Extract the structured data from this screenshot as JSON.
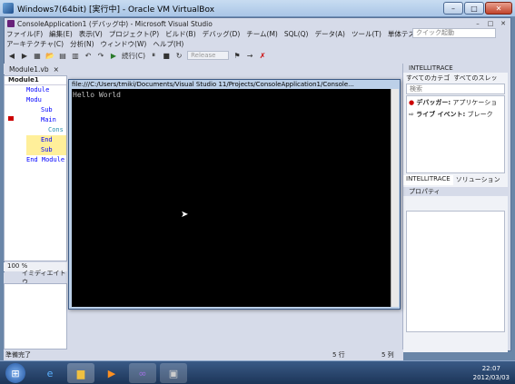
{
  "vbox_title": "Windows7(64bit) [実行中] - Oracle VM VirtualBox",
  "vs_title": "ConsoleApplication1 (デバッグ中) - Microsoft Visual Studio",
  "menu": [
    "ファイル(F)",
    "編集(E)",
    "表示(V)",
    "プロジェクト(P)",
    "ビルド(B)",
    "デバッグ(D)",
    "チーム(M)",
    "SQL(Q)",
    "データ(A)",
    "ツール(T)",
    "単体テスト(U)"
  ],
  "menu2": [
    "アーキテクチャ(C)",
    "分析(N)",
    "ウィンドウ(W)",
    "ヘルプ(H)"
  ],
  "quick_launch": "クイック起動",
  "toolbar": {
    "continue": "続行(C)",
    "config": "Release"
  },
  "editor": {
    "tab": "Module1.vb",
    "module_combo": "Module1",
    "lines": [
      "Module Modu",
      "Sub Main",
      "Cons",
      "End Sub",
      "End Module"
    ],
    "zoom": "100 %"
  },
  "immediate_tab": "イミディエイト ウ",
  "console": {
    "title": "file:///C:/Users/tmiki/Documents/Visual Studio 11/Projects/ConsoleApplication1/Console...",
    "output": "Hello World"
  },
  "intellitrace": {
    "header": "INTELLITRACE",
    "filter1": "すべてのカテゴ",
    "filter2": "すべてのスレッ",
    "search": "検索",
    "events": [
      {
        "label": "デバッガー:",
        "text": "アプリケーショ"
      },
      {
        "label": "ライブ イベント:",
        "text": "ブレーク"
      }
    ],
    "tab1": "INTELLITRACE",
    "tab2": "ソリューション"
  },
  "properties": {
    "header": "プロパティ"
  },
  "status": {
    "ready": "準備完了",
    "line": "5 行",
    "col": "5 列"
  },
  "clock": {
    "time": "22:07",
    "date": "2012/03/03"
  },
  "colors": {
    "vs_bg": "#d6dbe9",
    "console_bg": "#000000",
    "taskbar": "#1c3558"
  }
}
